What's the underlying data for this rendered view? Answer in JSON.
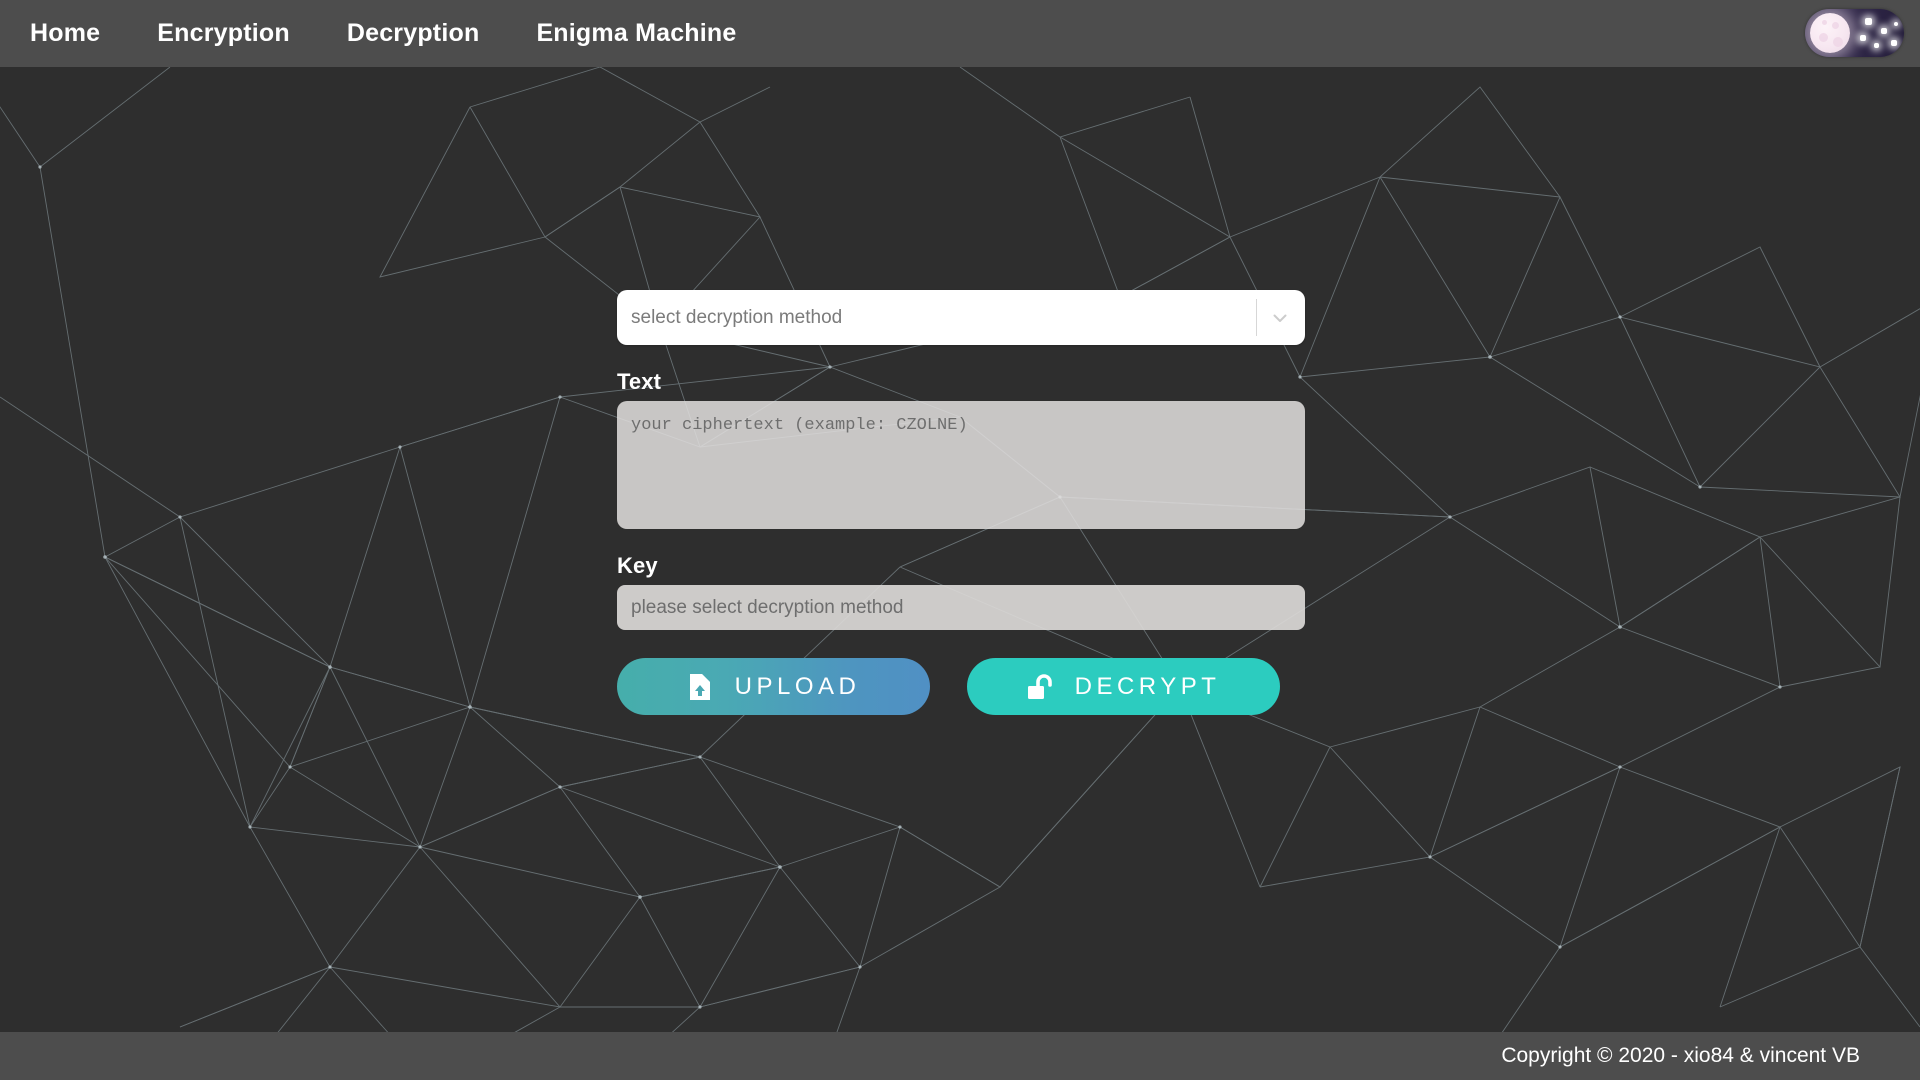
{
  "app": {
    "background_color": "#2e2e2e",
    "bar_color": "#4d4d4d",
    "accent_teal": "#2cccbf",
    "accent_blue": "#5090c4"
  },
  "navbar": {
    "links": [
      {
        "label": "Home",
        "name": "nav-link-home"
      },
      {
        "label": "Encryption",
        "name": "nav-link-encryption"
      },
      {
        "label": "Decryption",
        "name": "nav-link-decryption"
      },
      {
        "label": "Enigma Machine",
        "name": "nav-link-enigma-machine"
      }
    ],
    "theme_toggle": {
      "icon": "moon-and-stars-icon",
      "state": "dark"
    }
  },
  "form": {
    "method_select": {
      "value": "select decryption method",
      "icon": "chevron-down-icon"
    },
    "text_field": {
      "label": "Text",
      "placeholder": "your ciphertext (example: CZOLNE)",
      "value": ""
    },
    "key_field": {
      "label": "Key",
      "placeholder": "please select decryption method",
      "value": ""
    },
    "buttons": {
      "upload": {
        "label": "UPLOAD",
        "icon": "file-upload-icon"
      },
      "decrypt": {
        "label": "DECRYPT",
        "icon": "unlock-icon"
      }
    }
  },
  "footer": {
    "copyright": "Copyright © 2020 - xio84 & vincent VB"
  }
}
